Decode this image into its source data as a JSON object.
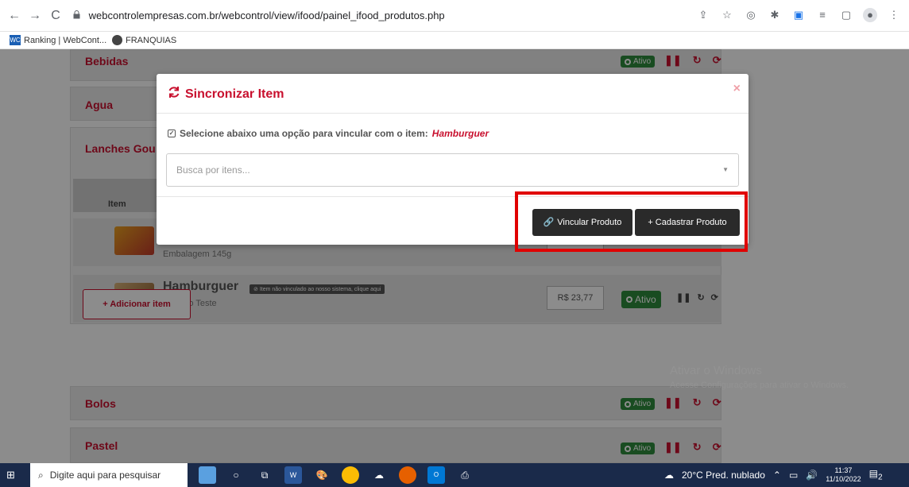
{
  "browser": {
    "back_glyph": "←",
    "forward_glyph": "→",
    "reload_glyph": "C",
    "url": "webcontrolempresas.com.br/webcontrol/view/ifood/painel_ifood_produtos.php",
    "lock_glyph": "🔒",
    "right_icons": [
      "share-icon",
      "star-icon",
      "camera-icon",
      "extensions-icon",
      "cast-icon",
      "playlist-icon",
      "sidepanel-icon",
      "profile-icon",
      "menu-icon"
    ]
  },
  "bookmarks": [
    {
      "icon_text": "WC",
      "label": "Ranking | WebCont..."
    },
    {
      "icon_text": "",
      "label": "FRANQUIAS"
    }
  ],
  "page": {
    "sections": [
      {
        "name": "Bebidas",
        "status": "Ativo"
      },
      {
        "name": "Agua",
        "status": ""
      },
      {
        "name": "Lanches Gou",
        "status": ""
      },
      {
        "name": "Bolos",
        "status": "Ativo"
      },
      {
        "name": "Pastel",
        "status": "Ativo"
      }
    ],
    "table_header_item": "Item",
    "products": [
      {
        "name": "",
        "description": "Embalagem 145g",
        "price": "",
        "status": ""
      },
      {
        "name": "Hamburguer",
        "badge": "Item não vinculado ao nosso sistema, clique aqui",
        "description": "Produto Teste",
        "price": "R$ 23,77",
        "status": "Ativo"
      }
    ],
    "add_item_label": "+ Adicionar item"
  },
  "modal": {
    "title": "Sincronizar Item",
    "close_glyph": "×",
    "instruction": "Selecione abaixo uma opção para vincular com o item:",
    "item_name": "Hamburguer",
    "search_placeholder": "Busca por itens...",
    "link_button": "Vincular Produto",
    "register_button": "+ Cadastrar Produto"
  },
  "watermark": {
    "line1": "Ativar o Windows",
    "line2": "Acesse Configurações para ativar o Windows."
  },
  "taskbar": {
    "search_placeholder": "Digite aqui para pesquisar",
    "weather": "20°C Pred. nublado",
    "time": "11:37",
    "date": "11/10/2022",
    "notif_count": "2"
  },
  "colors": {
    "brand_red": "#c8102e",
    "status_green": "#2e8b3c",
    "button_dark": "#2a2a2a",
    "highlight_red": "#e00000"
  }
}
